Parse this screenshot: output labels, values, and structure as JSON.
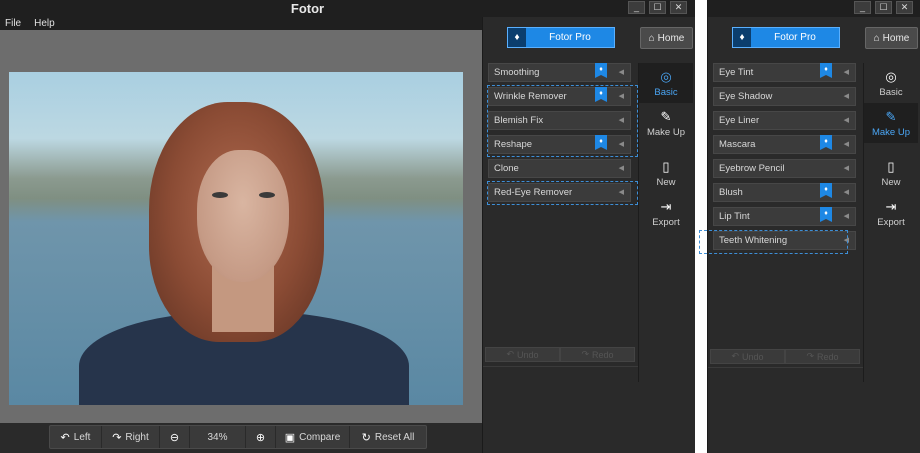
{
  "main_window": {
    "title": "Fotor",
    "window_buttons": [
      "_",
      "☐",
      "✕"
    ],
    "menu": [
      "File",
      "Help"
    ],
    "bottom_toolbar": {
      "rotate_left": "Left",
      "rotate_right": "Right",
      "zoom_level": "34%",
      "compare": "Compare",
      "reset_all": "Reset All"
    }
  },
  "basic_panel": {
    "pro_button": "Fotor Pro",
    "home_button": "Home",
    "tools": [
      {
        "label": "Smoothing",
        "pro": true
      },
      {
        "label": "Wrinkle Remover",
        "pro": true
      },
      {
        "label": "Blemish Fix",
        "pro": false
      },
      {
        "label": "Reshape",
        "pro": true
      },
      {
        "label": "Clone",
        "pro": false
      },
      {
        "label": "Red-Eye Remover",
        "pro": false
      }
    ],
    "undo": "Undo",
    "redo": "Redo",
    "nav": [
      {
        "label": "Basic",
        "icon": "basic-icon",
        "active": true
      },
      {
        "label": "Make Up",
        "icon": "makeup-icon",
        "active": false
      },
      {
        "label": "New",
        "icon": "new-file-icon",
        "active": false
      },
      {
        "label": "Export",
        "icon": "export-icon",
        "active": false
      }
    ]
  },
  "makeup_panel": {
    "window_buttons": [
      "_",
      "☐",
      "✕"
    ],
    "pro_button": "Fotor Pro",
    "home_button": "Home",
    "tools": [
      {
        "label": "Eye Tint",
        "pro": true
      },
      {
        "label": "Eye Shadow",
        "pro": false
      },
      {
        "label": "Eye Liner",
        "pro": false
      },
      {
        "label": "Mascara",
        "pro": true
      },
      {
        "label": "Eyebrow Pencil",
        "pro": false
      },
      {
        "label": "Blush",
        "pro": true
      },
      {
        "label": "Lip Tint",
        "pro": true
      },
      {
        "label": "Teeth Whitening",
        "pro": false
      }
    ],
    "undo": "Undo",
    "redo": "Redo",
    "nav": [
      {
        "label": "Basic",
        "icon": "basic-icon",
        "active": false
      },
      {
        "label": "Make Up",
        "icon": "makeup-icon",
        "active": true
      },
      {
        "label": "New",
        "icon": "new-file-icon",
        "active": false
      },
      {
        "label": "Export",
        "icon": "export-icon",
        "active": false
      }
    ]
  },
  "colors": {
    "accent": "#1e88e5",
    "panel_bg": "#2a2a2a",
    "active_nav_text": "#4aa6f5"
  }
}
